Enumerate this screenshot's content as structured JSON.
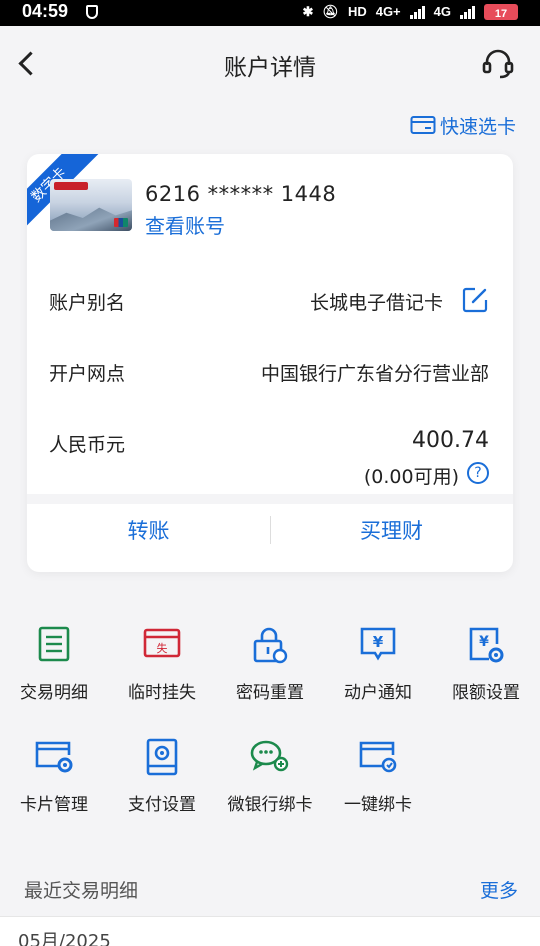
{
  "status_bar": {
    "time": "04:59",
    "network_hd": "HD",
    "network_4g_1": "4G+",
    "network_4g_2": "4G",
    "battery": "17"
  },
  "header": {
    "title": "账户详情",
    "back_icon": "back-arrow",
    "service_icon": "headset"
  },
  "quick_select": {
    "label": "快速选卡"
  },
  "card": {
    "badge": "数字卡",
    "number": "6216 ****** 1448",
    "view_account": "查看账号",
    "rows": [
      {
        "label": "账户别名",
        "value": "长城电子借记卡"
      },
      {
        "label": "开户网点",
        "value": "中国银行广东省分行营业部"
      },
      {
        "label": "人民币元",
        "value": "400.74"
      }
    ],
    "available": "(0.00可用)",
    "help": "?",
    "actions": [
      {
        "label": "转账"
      },
      {
        "label": "买理财"
      }
    ]
  },
  "functions": [
    {
      "label": "交易明细",
      "icon": "transaction-detail",
      "color": "#1c8a4c"
    },
    {
      "label": "临时挂失",
      "icon": "temporary-loss",
      "color": "#d02837"
    },
    {
      "label": "密码重置",
      "icon": "password-reset",
      "color": "#1a6ed8"
    },
    {
      "label": "动户通知",
      "icon": "account-notify",
      "color": "#1a6ed8"
    },
    {
      "label": "限额设置",
      "icon": "limit-setting",
      "color": "#1a6ed8"
    },
    {
      "label": "卡片管理",
      "icon": "card-manage",
      "color": "#1a6ed8"
    },
    {
      "label": "支付设置",
      "icon": "payment-setting",
      "color": "#1a6ed8"
    },
    {
      "label": "微银行绑卡",
      "icon": "wechat-bind",
      "color": "#1c8a4c"
    },
    {
      "label": "一键绑卡",
      "icon": "one-click-bind",
      "color": "#1a6ed8"
    }
  ],
  "recent": {
    "title": "最近交易明细",
    "more": "更多",
    "month": "05月/2025"
  },
  "colors": {
    "accent": "#1a6ed8",
    "background": "#f4f4f6",
    "ribbon": "#1565d8"
  }
}
